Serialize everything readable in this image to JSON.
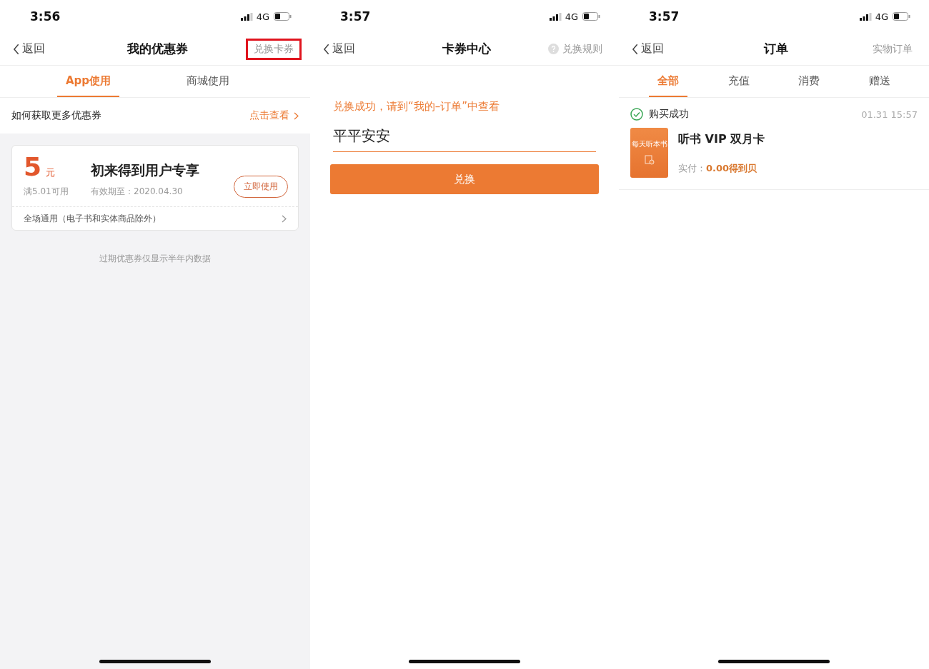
{
  "screens": [
    {
      "kind": "coupons",
      "status": {
        "time": "3:56",
        "network": "4G"
      },
      "nav": {
        "back": "返回",
        "title": "我的优惠券",
        "action": "兑换卡券",
        "highlighted": true
      },
      "tabs": [
        {
          "label": "App使用",
          "selected": true
        },
        {
          "label": "商城使用",
          "selected": false
        }
      ],
      "promo": {
        "text": "如何获取更多优惠券",
        "link": "点击查看"
      },
      "coupon": {
        "amount": "5",
        "unit": "元",
        "condition": "满5.01可用",
        "title": "初来得到用户专享",
        "validity": "有效期至：2020.04.30",
        "use_button": "立即使用",
        "scope": "全场通用（电子书和实体商品除外）"
      },
      "footnote": "过期优惠券仅显示半年内数据"
    },
    {
      "kind": "redeem",
      "status": {
        "time": "3:57",
        "network": "4G"
      },
      "nav": {
        "back": "返回",
        "title": "卡券中心",
        "action": "兑换规则",
        "highlighted": false
      },
      "message": "兑换成功，请到“我的–订单”中查看",
      "code_value": "平平安安",
      "button": "兑换"
    },
    {
      "kind": "orders",
      "status": {
        "time": "3:57",
        "network": "4G"
      },
      "nav": {
        "back": "返回",
        "title": "订单",
        "action": "实物订单",
        "highlighted": false
      },
      "tabs": [
        {
          "label": "全部",
          "selected": true
        },
        {
          "label": "充值",
          "selected": false
        },
        {
          "label": "消费",
          "selected": false
        },
        {
          "label": "赠送",
          "selected": false
        }
      ],
      "orders": [
        {
          "status": "购买成功",
          "time": "01.31  15:57",
          "thumbnail_text": "每天听本书",
          "title": "听书 VIP 双月卡",
          "paid_label": "实付：",
          "paid_amount": "0.00得到贝"
        }
      ]
    }
  ]
}
